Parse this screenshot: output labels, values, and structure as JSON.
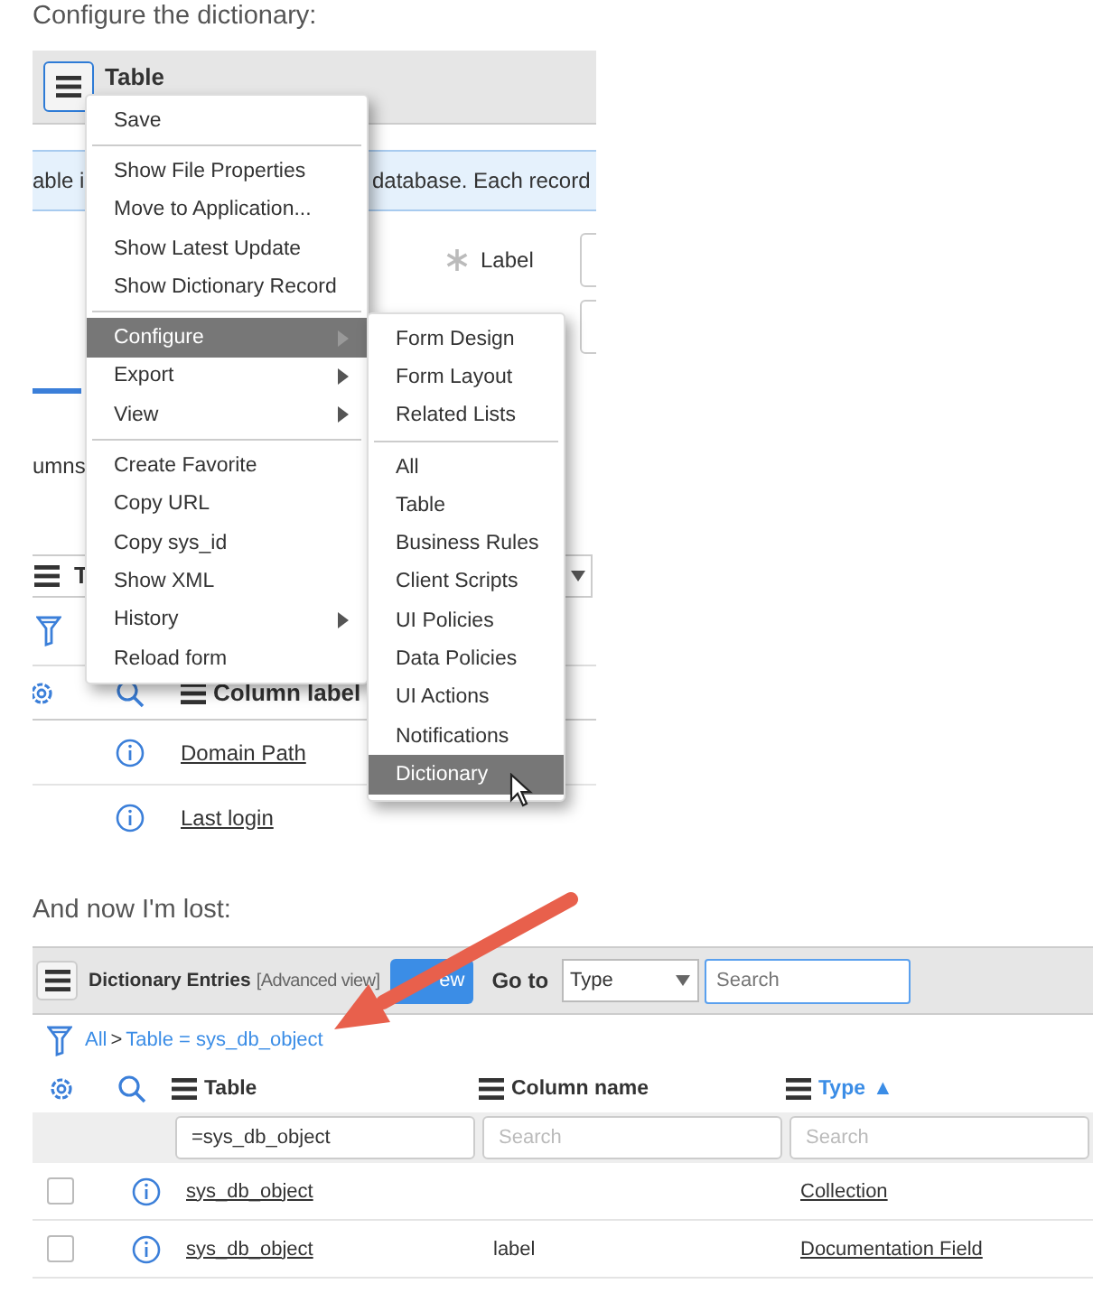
{
  "intro_text": "Configure the dictionary:",
  "form_screenshot": {
    "header": {
      "title": "Table"
    },
    "banner": [
      "able i",
      "database. Each record"
    ],
    "field_label": "Label",
    "tab_fragment": "umns",
    "toolbar_fragment": "T",
    "column_header": "Column label",
    "rows": [
      {
        "label": "Domain Path"
      },
      {
        "label": "Last login"
      }
    ],
    "context_menu": {
      "items": [
        {
          "kind": "item",
          "label": "Save",
          "selected": false,
          "has_submenu": false
        },
        {
          "kind": "divider"
        },
        {
          "kind": "item",
          "label": "Show File Properties",
          "selected": false,
          "has_submenu": false
        },
        {
          "kind": "item",
          "label": "Move to Application...",
          "selected": false,
          "has_submenu": false
        },
        {
          "kind": "item",
          "label": "Show Latest Update",
          "selected": false,
          "has_submenu": false
        },
        {
          "kind": "item",
          "label": "Show Dictionary Record",
          "selected": false,
          "has_submenu": false
        },
        {
          "kind": "divider"
        },
        {
          "kind": "item",
          "label": "Configure",
          "selected": true,
          "has_submenu": true
        },
        {
          "kind": "item",
          "label": "Export",
          "selected": false,
          "has_submenu": true
        },
        {
          "kind": "item",
          "label": "View",
          "selected": false,
          "has_submenu": true
        },
        {
          "kind": "divider"
        },
        {
          "kind": "item",
          "label": "Create Favorite",
          "selected": false,
          "has_submenu": false
        },
        {
          "kind": "item",
          "label": "Copy URL",
          "selected": false,
          "has_submenu": false
        },
        {
          "kind": "item",
          "label": "Copy sys_id",
          "selected": false,
          "has_submenu": false
        },
        {
          "kind": "item",
          "label": "Show XML",
          "selected": false,
          "has_submenu": false
        },
        {
          "kind": "item",
          "label": "History",
          "selected": false,
          "has_submenu": true
        },
        {
          "kind": "item",
          "label": "Reload form",
          "selected": false,
          "has_submenu": false
        }
      ]
    },
    "submenu": {
      "items": [
        {
          "kind": "item",
          "label": "Form Design",
          "selected": false
        },
        {
          "kind": "item",
          "label": "Form Layout",
          "selected": false
        },
        {
          "kind": "item",
          "label": "Related Lists",
          "selected": false
        },
        {
          "kind": "divider"
        },
        {
          "kind": "item",
          "label": "All",
          "selected": false
        },
        {
          "kind": "item",
          "label": "Table",
          "selected": false
        },
        {
          "kind": "item",
          "label": "Business Rules",
          "selected": false
        },
        {
          "kind": "item",
          "label": "Client Scripts",
          "selected": false
        },
        {
          "kind": "item",
          "label": "UI Policies",
          "selected": false
        },
        {
          "kind": "item",
          "label": "Data Policies",
          "selected": false
        },
        {
          "kind": "item",
          "label": "UI Actions",
          "selected": false
        },
        {
          "kind": "item",
          "label": "Notifications",
          "selected": false
        },
        {
          "kind": "item",
          "label": "Dictionary",
          "selected": true
        }
      ]
    }
  },
  "followup_text": "And now I'm lost:",
  "list_screenshot": {
    "title": "Dictionary Entries",
    "view": "[Advanced view]",
    "new_button": "ew",
    "goto_label": "Go to",
    "goto_select": "Type",
    "search": {
      "placeholder": "Search"
    },
    "breadcrumb": {
      "items": [
        "All",
        "Table = sys_db_object"
      ],
      "separator": ">"
    },
    "columns": [
      {
        "label": "Table"
      },
      {
        "label": "Column name"
      },
      {
        "label": "Type",
        "sort_mark": "▲"
      }
    ],
    "filters": [
      {
        "value": "=sys_db_object"
      },
      {
        "placeholder": "Search"
      },
      {
        "placeholder": "Search"
      }
    ],
    "rows": [
      {
        "checked": false,
        "table": "sys_db_object",
        "type": "Collection"
      },
      {
        "checked": false,
        "table": "sys_db_object",
        "column_name": "label",
        "type": "Documentation Field"
      }
    ]
  }
}
